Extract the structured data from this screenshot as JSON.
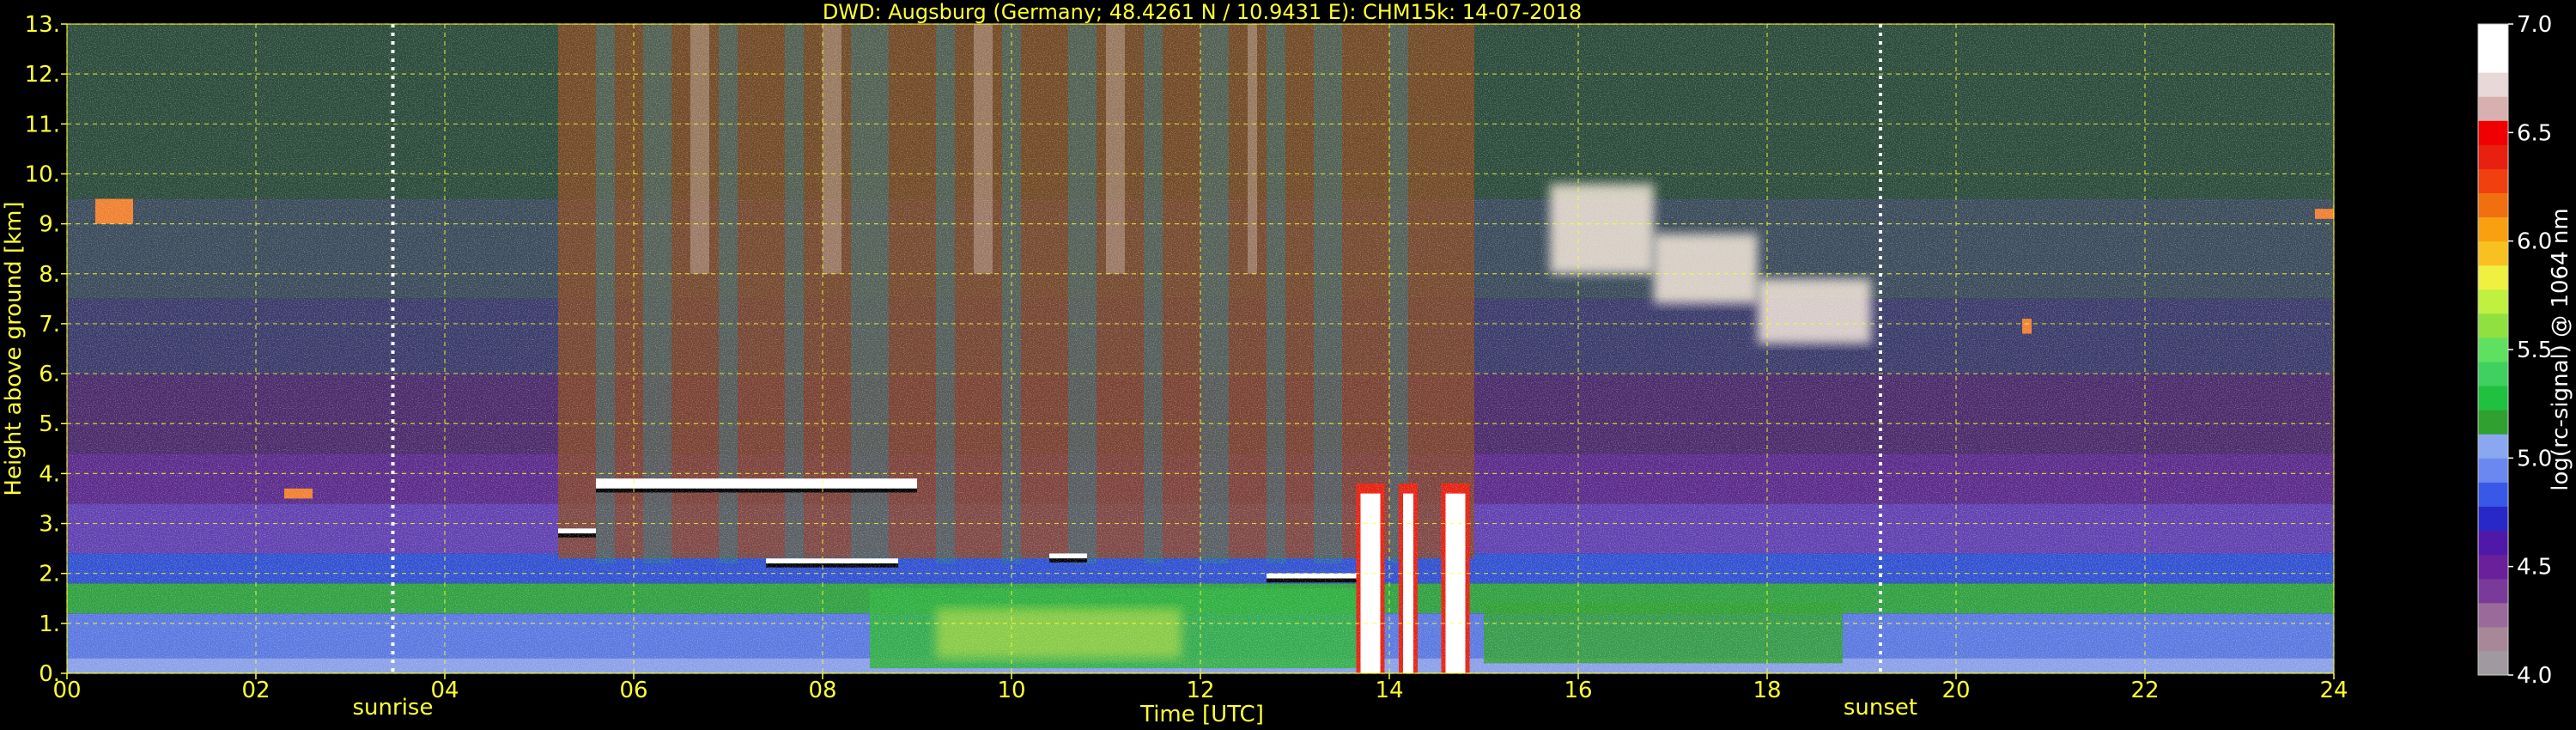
{
  "chart_data": {
    "type": "heatmap",
    "title": "DWD: Augsburg (Germany; 48.4261 N / 10.9431 E):    CHM15k: 14-07-2018",
    "xlabel": "Time [UTC]",
    "ylabel": "Height above ground [km]",
    "xlim": [
      0,
      24
    ],
    "ylim": [
      0,
      13
    ],
    "x_ticks": [
      "00",
      "02",
      "04",
      "06",
      "08",
      "10",
      "12",
      "14",
      "16",
      "18",
      "20",
      "22",
      "24"
    ],
    "y_ticks": [
      "0.",
      "1.",
      "2.",
      "3.",
      "4.",
      "5.",
      "6.",
      "7.",
      "8.",
      "9.",
      "10.",
      "11.",
      "12.",
      "13."
    ],
    "grid": true,
    "annotations": [
      {
        "label": "sunrise",
        "x": 3.45
      },
      {
        "label": "sunset",
        "x": 19.2
      }
    ],
    "colorbar": {
      "label": "log(rc-signal) @ 1064 nm",
      "min": 4.0,
      "max": 7.0,
      "ticks": [
        "4.0",
        "4.5",
        "5.0",
        "5.5",
        "6.0",
        "6.5",
        "7.0"
      ],
      "colors": [
        "#a09aa0",
        "#a88898",
        "#9a6a9a",
        "#7a3a9a",
        "#6a209a",
        "#5018a8",
        "#2828c8",
        "#3a58e8",
        "#6a88f0",
        "#8aa8f0",
        "#30a030",
        "#20c040",
        "#40d060",
        "#60e060",
        "#90e040",
        "#c0f040",
        "#f0f040",
        "#f8c020",
        "#f8a010",
        "#f07010",
        "#f04010",
        "#e82010",
        "#f00000",
        "#d8b0b0",
        "#e8d8d8",
        "#ffffff",
        "#ffffff"
      ]
    },
    "features": [
      {
        "name": "boundary-layer",
        "x_range": [
          0,
          24
        ],
        "y_range": [
          0,
          2.2
        ]
      },
      {
        "name": "cloud-layer-low",
        "x_range": [
          5.2,
          11
        ],
        "y_range": [
          2.2,
          4.0
        ]
      },
      {
        "name": "cirrus",
        "x_range": [
          15.5,
          19.5
        ],
        "y_range": [
          6.5,
          10
        ]
      },
      {
        "name": "precipitation",
        "x_range": [
          13.6,
          14.9
        ],
        "y_range": [
          0,
          4.1
        ]
      }
    ]
  }
}
